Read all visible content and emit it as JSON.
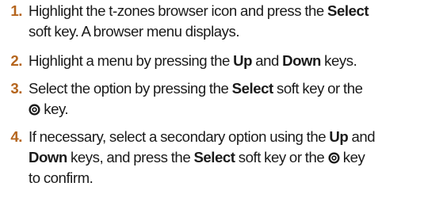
{
  "steps": [
    {
      "number": "1.",
      "line1": "Highlight the t-zones browser icon and press the",
      "bold1": "Select",
      "line2": "soft key. A browser menu displays."
    },
    {
      "number": "2.",
      "text1": "Highlight a menu by pressing the",
      "bold1": "Up",
      "text2": "and",
      "bold2": "Down",
      "text3": "keys."
    },
    {
      "number": "3.",
      "text1": "Select the option by pressing the",
      "bold1": "Select",
      "text2": "soft key or the",
      "text3": "key.",
      "icon": "center-key-icon"
    },
    {
      "number": "4.",
      "text1": "If necessary, select a secondary option using the",
      "bold1": "Up",
      "text2": "and",
      "bold2": "Down",
      "text3": "keys, and press the",
      "bold3": "Select",
      "text4": "soft key or the",
      "text5": "key",
      "text6": "to confirm.",
      "icon": "center-key-icon"
    }
  ],
  "colors": {
    "step_number": "#b5651d",
    "text": "#1a1a1a"
  }
}
